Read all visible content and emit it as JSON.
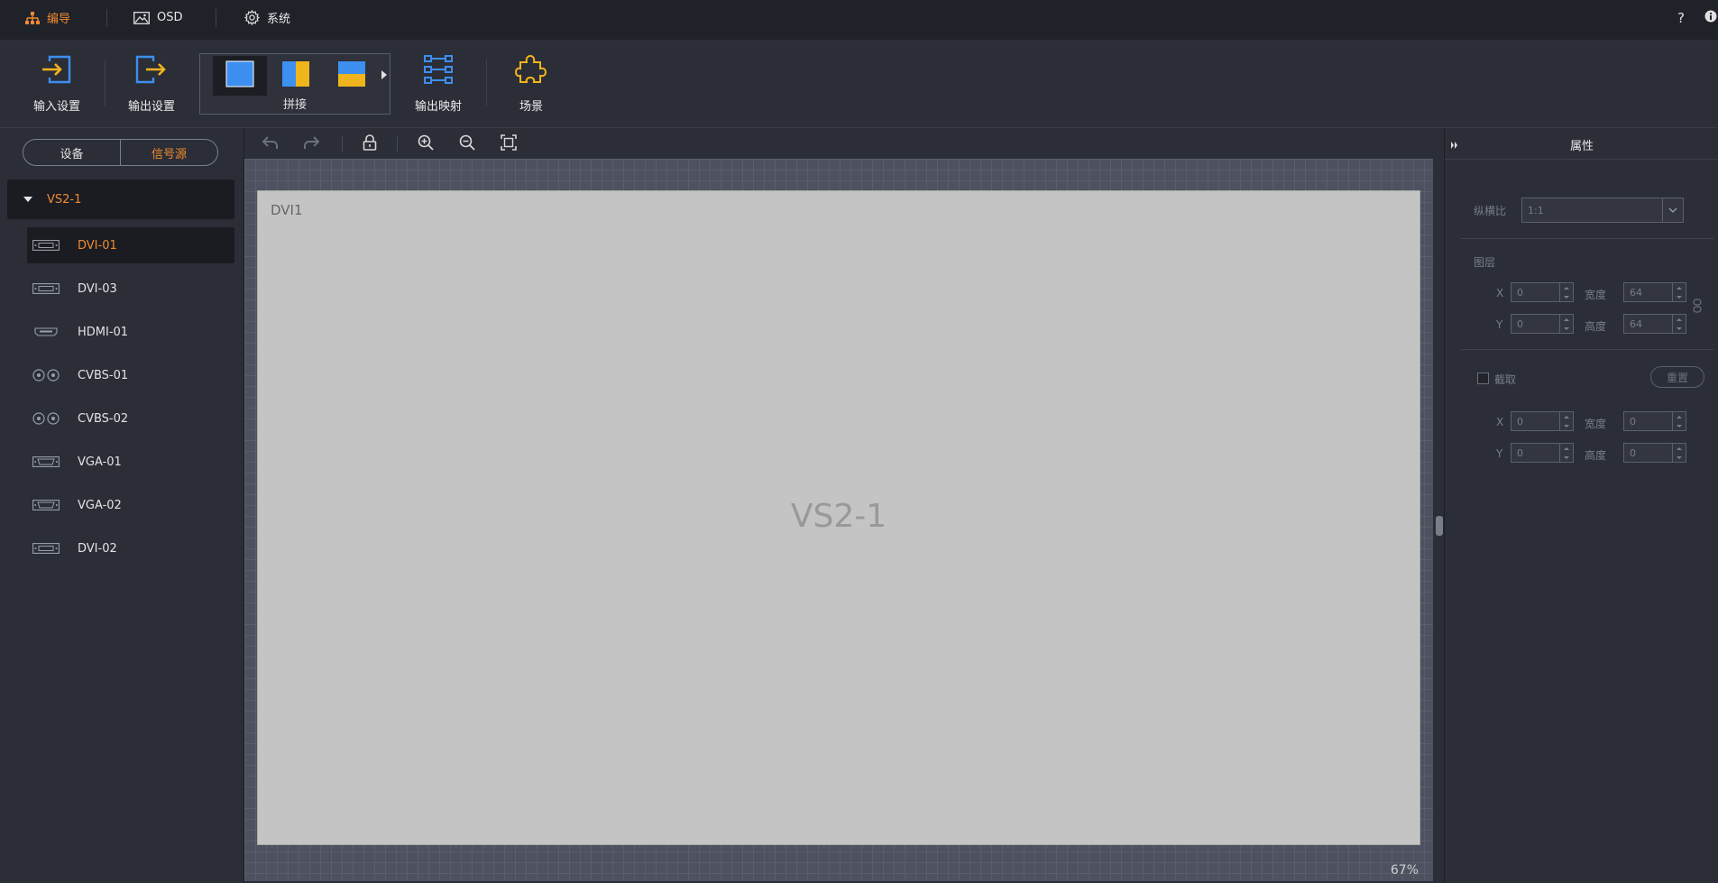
{
  "topnav": {
    "items": [
      {
        "label": "编导",
        "icon": "sitemap-icon",
        "active": true
      },
      {
        "label": "OSD",
        "icon": "image-icon",
        "active": false
      },
      {
        "label": "系统",
        "icon": "gear-icon",
        "active": false
      }
    ],
    "help": "?",
    "info": "i"
  },
  "toolbar": {
    "input_settings": "输入设置",
    "output_settings": "输出设置",
    "splice_label": "拼接",
    "output_mapping": "输出映射",
    "scene": "场景"
  },
  "left_panel": {
    "tabs": {
      "device": "设备",
      "signal_source": "信号源"
    },
    "tree_root": "VS2-1",
    "sources": [
      {
        "label": "DVI-01",
        "icon": "dvi-port-icon",
        "selected": true
      },
      {
        "label": "DVI-03",
        "icon": "dvi-port-icon",
        "selected": false
      },
      {
        "label": "HDMI-01",
        "icon": "hdmi-port-icon",
        "selected": false
      },
      {
        "label": "CVBS-01",
        "icon": "cvbs-port-icon",
        "selected": false
      },
      {
        "label": "CVBS-02",
        "icon": "cvbs-port-icon",
        "selected": false
      },
      {
        "label": "VGA-01",
        "icon": "vga-port-icon",
        "selected": false
      },
      {
        "label": "VGA-02",
        "icon": "vga-port-icon",
        "selected": false
      },
      {
        "label": "DVI-02",
        "icon": "dvi-port-icon",
        "selected": false
      }
    ]
  },
  "canvas": {
    "window_label": "DVI1",
    "screen_label": "VS2-1",
    "zoom": "67%"
  },
  "properties": {
    "title": "属性",
    "aspect_ratio_label": "纵横比",
    "aspect_ratio_value": "1:1",
    "layer_section": "图层",
    "layer": {
      "x_label": "X",
      "x_value": "0",
      "y_label": "Y",
      "y_value": "0",
      "width_label": "宽度",
      "width_value": "64",
      "height_label": "高度",
      "height_value": "64"
    },
    "crop_label": "截取",
    "reset_label": "重置",
    "crop": {
      "x_label": "X",
      "x_value": "0",
      "y_label": "Y",
      "y_value": "0",
      "width_label": "宽度",
      "width_value": "0",
      "height_label": "高度",
      "height_value": "0"
    }
  },
  "colors": {
    "accent": "#f08a30",
    "blue": "#3d8ff0",
    "yellow": "#f0b41c"
  }
}
